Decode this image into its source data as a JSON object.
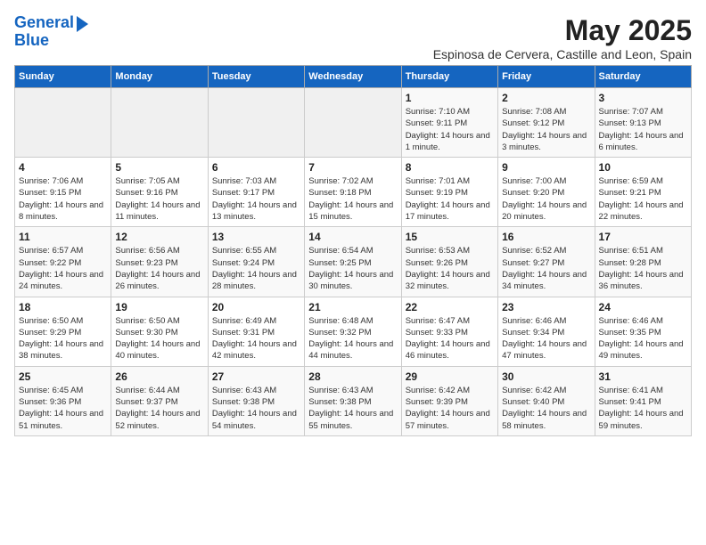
{
  "logo": {
    "line1": "General",
    "line2": "Blue"
  },
  "title": "May 2025",
  "subtitle": "Espinosa de Cervera, Castille and Leon, Spain",
  "days_of_week": [
    "Sunday",
    "Monday",
    "Tuesday",
    "Wednesday",
    "Thursday",
    "Friday",
    "Saturday"
  ],
  "weeks": [
    [
      {
        "day": "",
        "info": ""
      },
      {
        "day": "",
        "info": ""
      },
      {
        "day": "",
        "info": ""
      },
      {
        "day": "",
        "info": ""
      },
      {
        "day": "1",
        "info": "Sunrise: 7:10 AM\nSunset: 9:11 PM\nDaylight: 14 hours and 1 minute."
      },
      {
        "day": "2",
        "info": "Sunrise: 7:08 AM\nSunset: 9:12 PM\nDaylight: 14 hours and 3 minutes."
      },
      {
        "day": "3",
        "info": "Sunrise: 7:07 AM\nSunset: 9:13 PM\nDaylight: 14 hours and 6 minutes."
      }
    ],
    [
      {
        "day": "4",
        "info": "Sunrise: 7:06 AM\nSunset: 9:15 PM\nDaylight: 14 hours and 8 minutes."
      },
      {
        "day": "5",
        "info": "Sunrise: 7:05 AM\nSunset: 9:16 PM\nDaylight: 14 hours and 11 minutes."
      },
      {
        "day": "6",
        "info": "Sunrise: 7:03 AM\nSunset: 9:17 PM\nDaylight: 14 hours and 13 minutes."
      },
      {
        "day": "7",
        "info": "Sunrise: 7:02 AM\nSunset: 9:18 PM\nDaylight: 14 hours and 15 minutes."
      },
      {
        "day": "8",
        "info": "Sunrise: 7:01 AM\nSunset: 9:19 PM\nDaylight: 14 hours and 17 minutes."
      },
      {
        "day": "9",
        "info": "Sunrise: 7:00 AM\nSunset: 9:20 PM\nDaylight: 14 hours and 20 minutes."
      },
      {
        "day": "10",
        "info": "Sunrise: 6:59 AM\nSunset: 9:21 PM\nDaylight: 14 hours and 22 minutes."
      }
    ],
    [
      {
        "day": "11",
        "info": "Sunrise: 6:57 AM\nSunset: 9:22 PM\nDaylight: 14 hours and 24 minutes."
      },
      {
        "day": "12",
        "info": "Sunrise: 6:56 AM\nSunset: 9:23 PM\nDaylight: 14 hours and 26 minutes."
      },
      {
        "day": "13",
        "info": "Sunrise: 6:55 AM\nSunset: 9:24 PM\nDaylight: 14 hours and 28 minutes."
      },
      {
        "day": "14",
        "info": "Sunrise: 6:54 AM\nSunset: 9:25 PM\nDaylight: 14 hours and 30 minutes."
      },
      {
        "day": "15",
        "info": "Sunrise: 6:53 AM\nSunset: 9:26 PM\nDaylight: 14 hours and 32 minutes."
      },
      {
        "day": "16",
        "info": "Sunrise: 6:52 AM\nSunset: 9:27 PM\nDaylight: 14 hours and 34 minutes."
      },
      {
        "day": "17",
        "info": "Sunrise: 6:51 AM\nSunset: 9:28 PM\nDaylight: 14 hours and 36 minutes."
      }
    ],
    [
      {
        "day": "18",
        "info": "Sunrise: 6:50 AM\nSunset: 9:29 PM\nDaylight: 14 hours and 38 minutes."
      },
      {
        "day": "19",
        "info": "Sunrise: 6:50 AM\nSunset: 9:30 PM\nDaylight: 14 hours and 40 minutes."
      },
      {
        "day": "20",
        "info": "Sunrise: 6:49 AM\nSunset: 9:31 PM\nDaylight: 14 hours and 42 minutes."
      },
      {
        "day": "21",
        "info": "Sunrise: 6:48 AM\nSunset: 9:32 PM\nDaylight: 14 hours and 44 minutes."
      },
      {
        "day": "22",
        "info": "Sunrise: 6:47 AM\nSunset: 9:33 PM\nDaylight: 14 hours and 46 minutes."
      },
      {
        "day": "23",
        "info": "Sunrise: 6:46 AM\nSunset: 9:34 PM\nDaylight: 14 hours and 47 minutes."
      },
      {
        "day": "24",
        "info": "Sunrise: 6:46 AM\nSunset: 9:35 PM\nDaylight: 14 hours and 49 minutes."
      }
    ],
    [
      {
        "day": "25",
        "info": "Sunrise: 6:45 AM\nSunset: 9:36 PM\nDaylight: 14 hours and 51 minutes."
      },
      {
        "day": "26",
        "info": "Sunrise: 6:44 AM\nSunset: 9:37 PM\nDaylight: 14 hours and 52 minutes."
      },
      {
        "day": "27",
        "info": "Sunrise: 6:43 AM\nSunset: 9:38 PM\nDaylight: 14 hours and 54 minutes."
      },
      {
        "day": "28",
        "info": "Sunrise: 6:43 AM\nSunset: 9:38 PM\nDaylight: 14 hours and 55 minutes."
      },
      {
        "day": "29",
        "info": "Sunrise: 6:42 AM\nSunset: 9:39 PM\nDaylight: 14 hours and 57 minutes."
      },
      {
        "day": "30",
        "info": "Sunrise: 6:42 AM\nSunset: 9:40 PM\nDaylight: 14 hours and 58 minutes."
      },
      {
        "day": "31",
        "info": "Sunrise: 6:41 AM\nSunset: 9:41 PM\nDaylight: 14 hours and 59 minutes."
      }
    ]
  ]
}
